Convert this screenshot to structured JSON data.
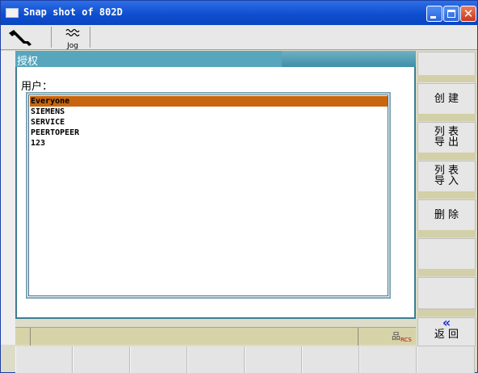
{
  "window": {
    "title": "Snap shot of 802D"
  },
  "toolbar": {
    "jog_label": "Jog"
  },
  "panel": {
    "title": "授权",
    "user_label": "用户："
  },
  "users": [
    {
      "name": "Everyone",
      "selected": true
    },
    {
      "name": "SIEMENS",
      "selected": false
    },
    {
      "name": "SERVICE",
      "selected": false
    },
    {
      "name": "PEERTOPEER",
      "selected": false
    },
    {
      "name": "123",
      "selected": false
    }
  ],
  "softkeys_right": [
    {
      "label": ""
    },
    {
      "label": "创 建"
    },
    {
      "label": "列 表\n导 出"
    },
    {
      "label": "列 表\n导 入"
    },
    {
      "label": "删 除"
    },
    {
      "label": ""
    },
    {
      "label": ""
    },
    {
      "label": "返 回",
      "icon": "«"
    }
  ],
  "softkeys_bottom": [
    "",
    "",
    "",
    "",
    "",
    "",
    "",
    ""
  ],
  "colors": {
    "selection": "#c8660f",
    "header": "#57a6bd",
    "statusbar": "#d7d3a9"
  }
}
